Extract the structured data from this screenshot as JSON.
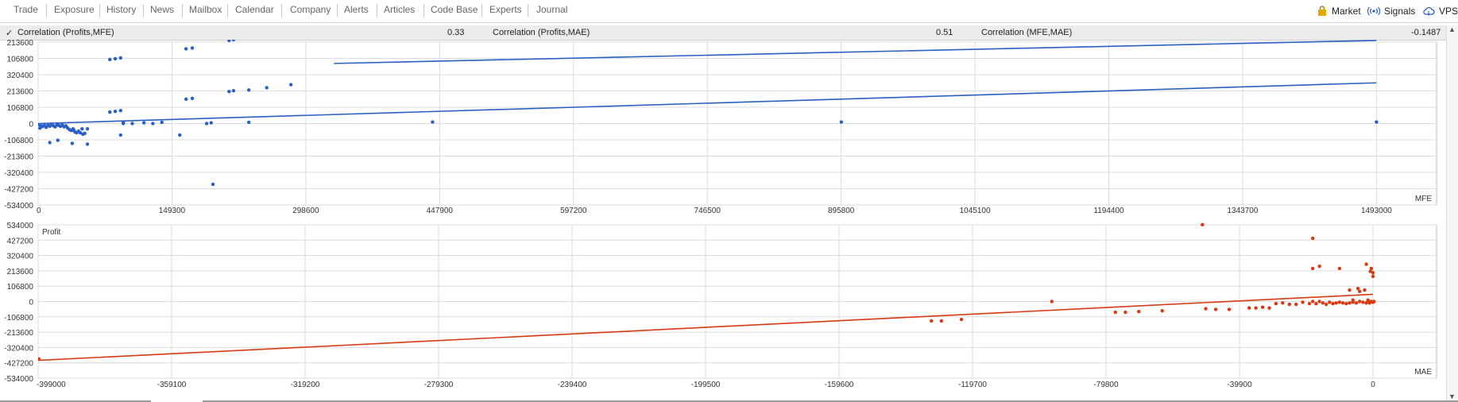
{
  "tabs": [
    "Trade",
    "Exposure",
    "History",
    "News",
    "Mailbox",
    "Calendar",
    "Company",
    "Alerts",
    "Articles",
    "Code Base",
    "Experts",
    "Journal"
  ],
  "right_links": {
    "market": "Market",
    "signals": "Signals",
    "vps": "VPS"
  },
  "correlation": {
    "check": "✓",
    "mfe_label": "Correlation (Profits,MFE)",
    "mfe_value": "0.33",
    "mae_label": "Correlation (Profits,MAE)",
    "mae_value": "0.51",
    "mfe_mae_label": "Correlation (MFE,MAE)",
    "mfe_mae_value": "-0.1487"
  },
  "colors": {
    "mfe": "#2a5fc4",
    "mae": "#d63a12",
    "grid": "#dcdcdc"
  },
  "chart_data": [
    {
      "type": "scatter",
      "xlabel": "MFE",
      "ylabel": "",
      "x_ticks": [
        "0",
        "149300",
        "298600",
        "447900",
        "597200",
        "746500",
        "895800",
        "1045100",
        "1194400",
        "1343700",
        "1493000"
      ],
      "y_ticks": [
        "213600",
        "106800",
        "320400",
        "213600",
        "106800",
        "0",
        "-106800",
        "-213600",
        "-320400",
        "-427200",
        "-534000"
      ],
      "xlim": [
        0,
        1560000
      ],
      "ylim": [
        -534000,
        534000
      ],
      "trend_lines": [
        {
          "x": [
            0,
            1493000
          ],
          "y": [
            0,
            267000
          ]
        },
        {
          "x": [
            330000,
            1493000
          ],
          "y": [
            394000,
            545000
          ]
        }
      ],
      "points": [
        [
          500,
          -8000
        ],
        [
          2000,
          -30000
        ],
        [
          3500,
          -15000
        ],
        [
          5000,
          -20000
        ],
        [
          7000,
          -12000
        ],
        [
          9000,
          -25000
        ],
        [
          11000,
          -10000
        ],
        [
          13000,
          -18000
        ],
        [
          15000,
          -5000
        ],
        [
          17000,
          -15000
        ],
        [
          19000,
          -22000
        ],
        [
          21000,
          -8000
        ],
        [
          23000,
          -12000
        ],
        [
          25000,
          -18000
        ],
        [
          27000,
          -9000
        ],
        [
          29000,
          -22000
        ],
        [
          31000,
          -15000
        ],
        [
          33000,
          -30000
        ],
        [
          35000,
          -40000
        ],
        [
          37000,
          -45000
        ],
        [
          39000,
          -35000
        ],
        [
          41000,
          -55000
        ],
        [
          43000,
          -60000
        ],
        [
          45000,
          -50000
        ],
        [
          47000,
          -60000
        ],
        [
          49000,
          -35000
        ],
        [
          52000,
          -65000
        ],
        [
          55000,
          -35000
        ],
        [
          13000,
          -125000
        ],
        [
          38000,
          -130000
        ],
        [
          55000,
          -135000
        ],
        [
          22000,
          -110000
        ],
        [
          40000,
          -45000
        ],
        [
          50000,
          -70000
        ],
        [
          80000,
          420000
        ],
        [
          86000,
          425000
        ],
        [
          92000,
          430000
        ],
        [
          80000,
          75000
        ],
        [
          86000,
          80000
        ],
        [
          92000,
          85000
        ],
        [
          95000,
          0
        ],
        [
          92000,
          -75000
        ],
        [
          95000,
          8000
        ],
        [
          105000,
          0
        ],
        [
          118000,
          5000
        ],
        [
          128000,
          0
        ],
        [
          138000,
          8000
        ],
        [
          165000,
          490000
        ],
        [
          172000,
          495000
        ],
        [
          165000,
          160000
        ],
        [
          172000,
          165000
        ],
        [
          158000,
          -75000
        ],
        [
          188000,
          0
        ],
        [
          193000,
          5000
        ],
        [
          213000,
          545000
        ],
        [
          218000,
          550000
        ],
        [
          235000,
          560000
        ],
        [
          255000,
          570000
        ],
        [
          282000,
          580000
        ],
        [
          213000,
          210000
        ],
        [
          218000,
          215000
        ],
        [
          235000,
          220000
        ],
        [
          255000,
          235000
        ],
        [
          282000,
          255000
        ],
        [
          235000,
          8000
        ],
        [
          195000,
          -398000
        ],
        [
          440000,
          10000
        ],
        [
          896000,
          10000
        ],
        [
          1493000,
          10000
        ]
      ]
    },
    {
      "type": "scatter",
      "title": "Profit",
      "xlabel": "MAE",
      "ylabel": "Profit",
      "x_ticks": [
        "-399000",
        "-359100",
        "-319200",
        "-279300",
        "-239400",
        "-199500",
        "-159600",
        "-119700",
        "-79800",
        "-39900",
        "0"
      ],
      "y_ticks": [
        "534000",
        "427200",
        "320400",
        "213600",
        "106800",
        "0",
        "-106800",
        "-213600",
        "-320400",
        "-427200",
        "-534000"
      ],
      "xlim": [
        -399000,
        19000
      ],
      "ylim": [
        -534000,
        534000
      ],
      "trend_lines": [
        {
          "x": [
            -399000,
            0
          ],
          "y": [
            -410000,
            50000
          ]
        }
      ],
      "points": [
        [
          -398800,
          -400000
        ],
        [
          -132000,
          -135000
        ],
        [
          -129000,
          -135000
        ],
        [
          -123000,
          -125000
        ],
        [
          -96000,
          0
        ],
        [
          -77000,
          -75000
        ],
        [
          -74000,
          -75000
        ],
        [
          -70000,
          -70000
        ],
        [
          -63000,
          -65000
        ],
        [
          -51000,
          535000
        ],
        [
          -50000,
          -50000
        ],
        [
          -47000,
          -55000
        ],
        [
          -43000,
          -55000
        ],
        [
          -37000,
          -45000
        ],
        [
          -35000,
          -45000
        ],
        [
          -33000,
          -40000
        ],
        [
          -31000,
          -45000
        ],
        [
          -29000,
          -15000
        ],
        [
          -27000,
          -10000
        ],
        [
          -25000,
          -20000
        ],
        [
          -23000,
          -20000
        ],
        [
          -21000,
          -5000
        ],
        [
          -19000,
          -15000
        ],
        [
          -18000,
          0
        ],
        [
          -17000,
          -15000
        ],
        [
          -16000,
          0
        ],
        [
          -15000,
          -10000
        ],
        [
          -14000,
          -20000
        ],
        [
          -13000,
          -5000
        ],
        [
          -12000,
          -15000
        ],
        [
          -11000,
          -10000
        ],
        [
          -10000,
          -5000
        ],
        [
          -9000,
          -10000
        ],
        [
          -8000,
          -15000
        ],
        [
          -7000,
          -10000
        ],
        [
          -6000,
          -5000
        ],
        [
          -5000,
          -10000
        ],
        [
          -4000,
          0
        ],
        [
          -3000,
          -5000
        ],
        [
          -2000,
          -10000
        ],
        [
          -1000,
          -5000
        ],
        [
          -500,
          0
        ],
        [
          0,
          -5000
        ],
        [
          -18000,
          440000
        ],
        [
          -18000,
          230000
        ],
        [
          -16000,
          245000
        ],
        [
          -10000,
          230000
        ],
        [
          -7000,
          80000
        ],
        [
          -6000,
          10000
        ],
        [
          -4500,
          90000
        ],
        [
          -4000,
          70000
        ],
        [
          -2500,
          80000
        ],
        [
          -2000,
          260000
        ],
        [
          -1500,
          10000
        ],
        [
          -1000,
          -10000
        ],
        [
          -800,
          210000
        ],
        [
          -500,
          230000
        ],
        [
          0,
          200000
        ],
        [
          0,
          175000
        ],
        [
          300,
          0
        ]
      ]
    }
  ]
}
